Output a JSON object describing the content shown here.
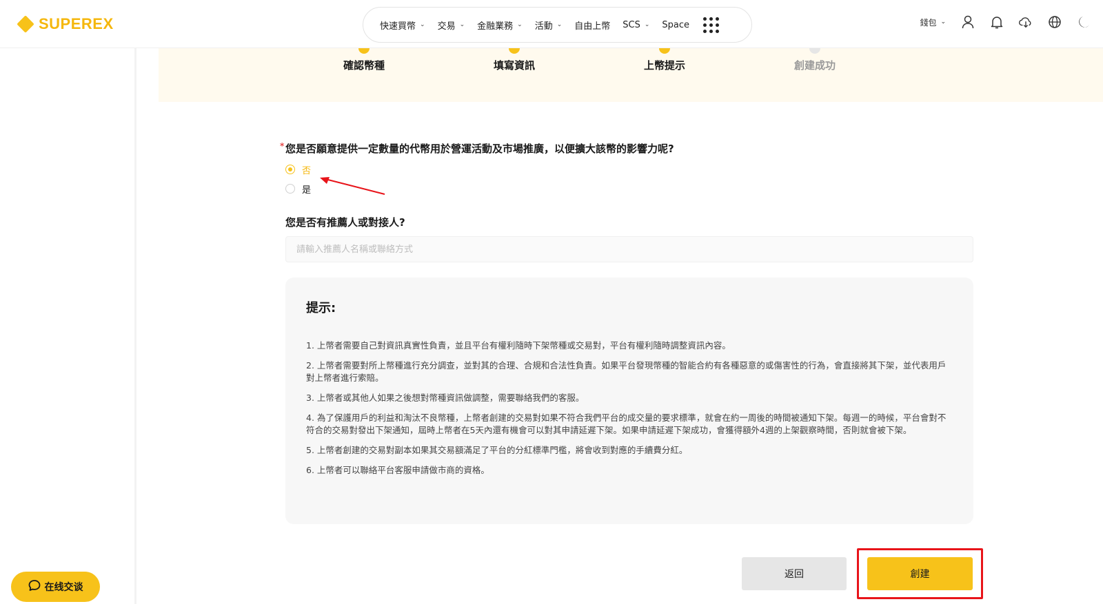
{
  "header": {
    "logo_text": "SUPEREX",
    "nav": [
      {
        "label": "快速買幣",
        "chevron": true
      },
      {
        "label": "交易",
        "chevron": true
      },
      {
        "label": "金融業務",
        "chevron": true
      },
      {
        "label": "活動",
        "chevron": true
      },
      {
        "label": "自由上幣",
        "chevron": false
      },
      {
        "label": "SCS",
        "chevron": true
      },
      {
        "label": "Space",
        "chevron": false
      }
    ],
    "wallet_label": "錢包",
    "icons": [
      "user-icon",
      "bell-icon",
      "download-icon",
      "globe-icon",
      "moon-icon"
    ]
  },
  "steps": [
    {
      "label": "確認幣種",
      "done": true
    },
    {
      "label": "填寫資訊",
      "done": true
    },
    {
      "label": "上幣提示",
      "done": true
    },
    {
      "label": "創建成功",
      "done": false
    }
  ],
  "form": {
    "question1": "您是否願意提供一定數量的代幣用於營運活動及市場推廣，以便擴大該幣的影響力呢?",
    "required_mark": "*",
    "options": [
      {
        "label": "否",
        "selected": true
      },
      {
        "label": "是",
        "selected": false
      }
    ],
    "question2": "您是否有推薦人或對接人?",
    "referrer_placeholder": "請輸入推薦人名稱或聯絡方式",
    "referrer_value": ""
  },
  "tips": {
    "title": "提示:",
    "items": [
      "1. 上幣者需要自己對資訊真實性負責，並且平台有權利隨時下架幣種或交易對，平台有權利隨時調整資訊內容。",
      "2. 上幣者需要對所上幣種進行充分調查，並對其的合理、合規和合法性負責。如果平台發現幣種的智能合約有各種惡意的或傷害性的行為，會直接將其下架，並代表用戶對上幣者進行索賠。",
      "3. 上幣者或其他人如果之後想對幣種資訊做調整，需要聯絡我們的客服。",
      "4. 為了保護用戶的利益和淘汰不良幣種，上幣者創建的交易對如果不符合我們平台的成交量的要求標準，就會在約一周後的時間被通知下架。每週一的時候，平台會對不符合的交易對發出下架通知，屆時上幣者在5天內還有機會可以對其申請延遲下架。如果申請延遲下架成功，會獲得額外4週的上架觀察時間，否則就會被下架。",
      "5. 上幣者創建的交易對副本如果其交易額滿足了平台的分紅標準門檻，將會收到對應的手續費分紅。",
      "6. 上幣者可以聯絡平台客服申請做市商的資格。"
    ]
  },
  "buttons": {
    "back": "返回",
    "create": "創建"
  },
  "chat": {
    "label": "在线交谈"
  },
  "colors": {
    "accent": "#f7c21a",
    "brand_text": "#f5b70d",
    "annotation_red": "#e8141a"
  }
}
